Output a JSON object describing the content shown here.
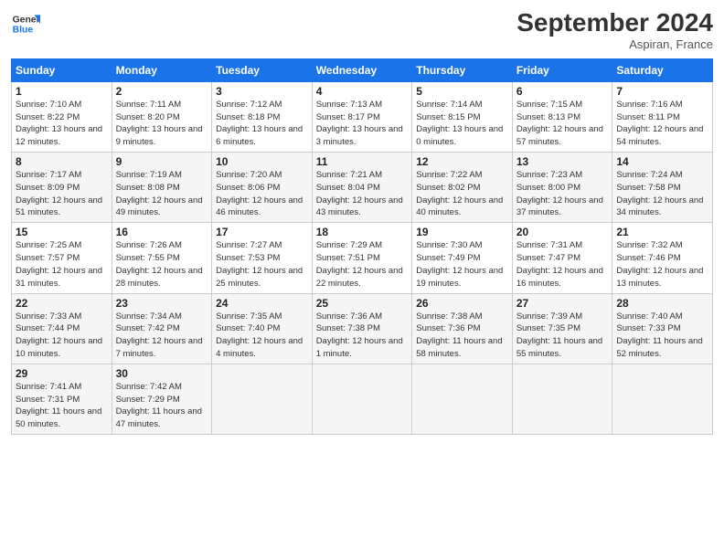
{
  "header": {
    "logo_line1": "General",
    "logo_line2": "Blue",
    "month_title": "September 2024",
    "subtitle": "Aspiran, France"
  },
  "days_of_week": [
    "Sunday",
    "Monday",
    "Tuesday",
    "Wednesday",
    "Thursday",
    "Friday",
    "Saturday"
  ],
  "weeks": [
    [
      {
        "day": "1",
        "sunrise": "7:10 AM",
        "sunset": "8:22 PM",
        "daylight": "13 hours and 12 minutes."
      },
      {
        "day": "2",
        "sunrise": "7:11 AM",
        "sunset": "8:20 PM",
        "daylight": "13 hours and 9 minutes."
      },
      {
        "day": "3",
        "sunrise": "7:12 AM",
        "sunset": "8:18 PM",
        "daylight": "13 hours and 6 minutes."
      },
      {
        "day": "4",
        "sunrise": "7:13 AM",
        "sunset": "8:17 PM",
        "daylight": "13 hours and 3 minutes."
      },
      {
        "day": "5",
        "sunrise": "7:14 AM",
        "sunset": "8:15 PM",
        "daylight": "13 hours and 0 minutes."
      },
      {
        "day": "6",
        "sunrise": "7:15 AM",
        "sunset": "8:13 PM",
        "daylight": "12 hours and 57 minutes."
      },
      {
        "day": "7",
        "sunrise": "7:16 AM",
        "sunset": "8:11 PM",
        "daylight": "12 hours and 54 minutes."
      }
    ],
    [
      {
        "day": "8",
        "sunrise": "7:17 AM",
        "sunset": "8:09 PM",
        "daylight": "12 hours and 51 minutes."
      },
      {
        "day": "9",
        "sunrise": "7:19 AM",
        "sunset": "8:08 PM",
        "daylight": "12 hours and 49 minutes."
      },
      {
        "day": "10",
        "sunrise": "7:20 AM",
        "sunset": "8:06 PM",
        "daylight": "12 hours and 46 minutes."
      },
      {
        "day": "11",
        "sunrise": "7:21 AM",
        "sunset": "8:04 PM",
        "daylight": "12 hours and 43 minutes."
      },
      {
        "day": "12",
        "sunrise": "7:22 AM",
        "sunset": "8:02 PM",
        "daylight": "12 hours and 40 minutes."
      },
      {
        "day": "13",
        "sunrise": "7:23 AM",
        "sunset": "8:00 PM",
        "daylight": "12 hours and 37 minutes."
      },
      {
        "day": "14",
        "sunrise": "7:24 AM",
        "sunset": "7:58 PM",
        "daylight": "12 hours and 34 minutes."
      }
    ],
    [
      {
        "day": "15",
        "sunrise": "7:25 AM",
        "sunset": "7:57 PM",
        "daylight": "12 hours and 31 minutes."
      },
      {
        "day": "16",
        "sunrise": "7:26 AM",
        "sunset": "7:55 PM",
        "daylight": "12 hours and 28 minutes."
      },
      {
        "day": "17",
        "sunrise": "7:27 AM",
        "sunset": "7:53 PM",
        "daylight": "12 hours and 25 minutes."
      },
      {
        "day": "18",
        "sunrise": "7:29 AM",
        "sunset": "7:51 PM",
        "daylight": "12 hours and 22 minutes."
      },
      {
        "day": "19",
        "sunrise": "7:30 AM",
        "sunset": "7:49 PM",
        "daylight": "12 hours and 19 minutes."
      },
      {
        "day": "20",
        "sunrise": "7:31 AM",
        "sunset": "7:47 PM",
        "daylight": "12 hours and 16 minutes."
      },
      {
        "day": "21",
        "sunrise": "7:32 AM",
        "sunset": "7:46 PM",
        "daylight": "12 hours and 13 minutes."
      }
    ],
    [
      {
        "day": "22",
        "sunrise": "7:33 AM",
        "sunset": "7:44 PM",
        "daylight": "12 hours and 10 minutes."
      },
      {
        "day": "23",
        "sunrise": "7:34 AM",
        "sunset": "7:42 PM",
        "daylight": "12 hours and 7 minutes."
      },
      {
        "day": "24",
        "sunrise": "7:35 AM",
        "sunset": "7:40 PM",
        "daylight": "12 hours and 4 minutes."
      },
      {
        "day": "25",
        "sunrise": "7:36 AM",
        "sunset": "7:38 PM",
        "daylight": "12 hours and 1 minute."
      },
      {
        "day": "26",
        "sunrise": "7:38 AM",
        "sunset": "7:36 PM",
        "daylight": "11 hours and 58 minutes."
      },
      {
        "day": "27",
        "sunrise": "7:39 AM",
        "sunset": "7:35 PM",
        "daylight": "11 hours and 55 minutes."
      },
      {
        "day": "28",
        "sunrise": "7:40 AM",
        "sunset": "7:33 PM",
        "daylight": "11 hours and 52 minutes."
      }
    ],
    [
      {
        "day": "29",
        "sunrise": "7:41 AM",
        "sunset": "7:31 PM",
        "daylight": "11 hours and 50 minutes."
      },
      {
        "day": "30",
        "sunrise": "7:42 AM",
        "sunset": "7:29 PM",
        "daylight": "11 hours and 47 minutes."
      },
      null,
      null,
      null,
      null,
      null
    ]
  ]
}
